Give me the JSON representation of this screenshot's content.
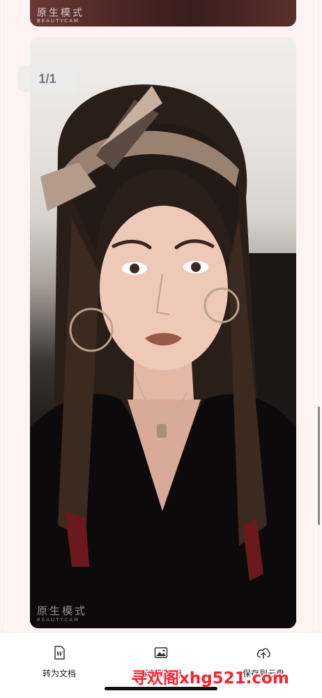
{
  "photos": {
    "top_watermark": "原生模式",
    "top_watermark_sub": "BEAUTYCAM",
    "main_watermark": "原生模式",
    "main_watermark_sub": "BEAUTYCAM"
  },
  "page_indicator": "1/1",
  "bottom_bar": {
    "actions": [
      {
        "label": "转为文档",
        "icon": "word-doc-icon"
      },
      {
        "label": "保存到相册",
        "icon": "image-icon"
      },
      {
        "label": "保存到云盘",
        "icon": "cloud-upload-icon"
      }
    ]
  },
  "overlay_watermark": "寻欢阁xhg521.com",
  "colors": {
    "background": "#fdf3f2",
    "watermark_red": "#ff1f2e"
  }
}
